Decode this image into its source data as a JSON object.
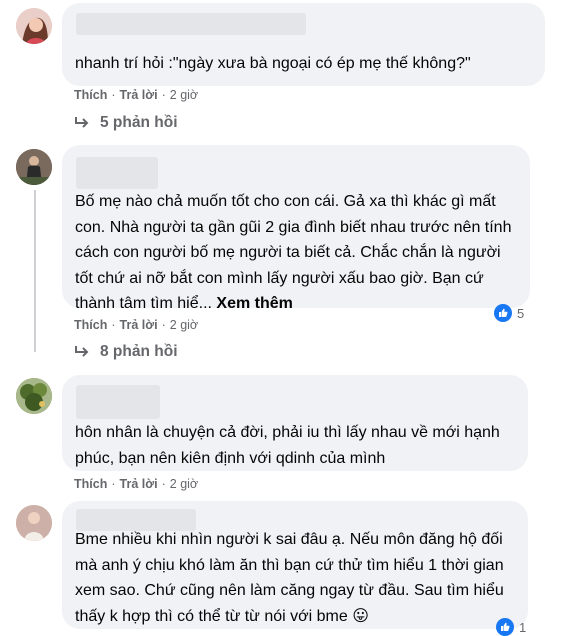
{
  "comments": [
    {
      "text": "nhanh trí hỏi :\"ngày xưa bà ngoại có ép mẹ thế không?\"",
      "actions": {
        "like": "Thích",
        "reply": "Trả lời",
        "time": "2 giờ"
      },
      "replies_label": "5 phản hồi"
    },
    {
      "text": "Bố mẹ nào chả muốn tốt cho con cái. Gả xa thì khác gì mất con. Nhà người ta gần gũi 2 gia đình biết nhau trước nên tính cách con người bố mẹ người ta biết cả. Chắc chắn là người tốt chứ ai nỡ bắt con mình lấy người xấu bao giờ. Bạn cứ thành tâm tìm hiể...",
      "see_more": "Xem thêm",
      "actions": {
        "like": "Thích",
        "reply": "Trả lời",
        "time": "2 giờ"
      },
      "reaction_count": "5",
      "replies_label": "8 phản hồi"
    },
    {
      "text": "hôn nhân là chuyện cả đời, phải iu thì lấy nhau về mới hạnh phúc, bạn nên kiên định với qdinh của mình",
      "actions": {
        "like": "Thích",
        "reply": "Trả lời",
        "time": "2 giờ"
      }
    },
    {
      "text": "Bme nhiều khi nhìn người k sai đâu ạ. Nếu môn đăng hộ đối mà anh ý chịu khó làm ăn thì bạn cứ thử tìm hiểu 1 thời gian xem sao. Chứ cũng nên làm căng ngay từ đầu. Sau tìm hiểu thấy k hợp thì có thể từ từ nói với bme",
      "emoji": "😛",
      "reaction_count": "1"
    }
  ],
  "colors": {
    "like_blue": "#1877f2",
    "bubble": "#f0f2f5",
    "meta": "#65676b"
  },
  "icons": [
    "reply-arrow-icon",
    "like-reaction-icon",
    "tongue-emoji-icon"
  ]
}
